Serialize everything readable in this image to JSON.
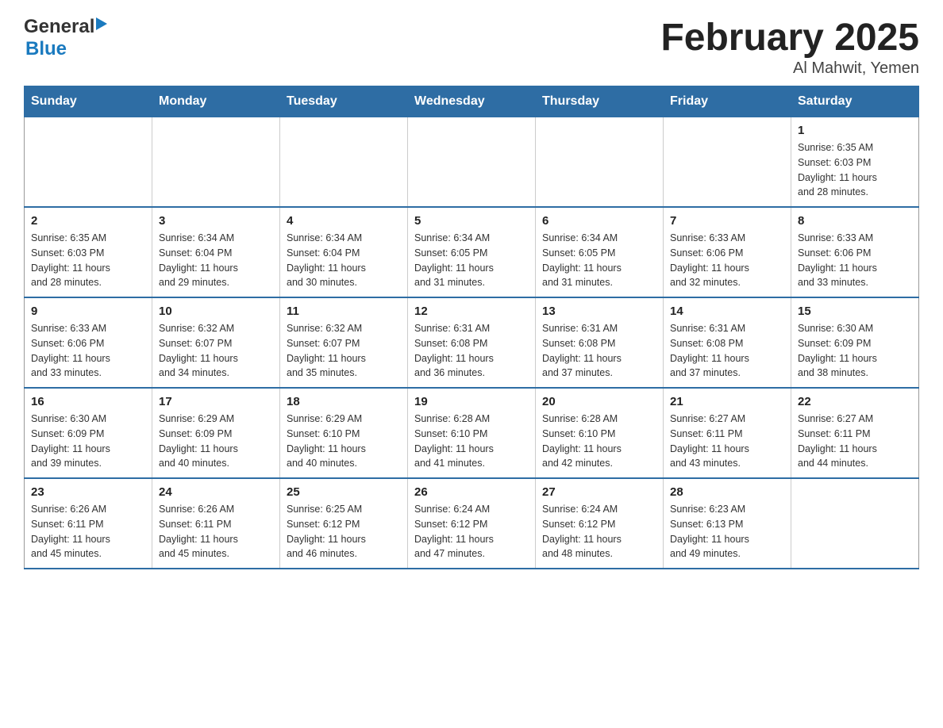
{
  "logo": {
    "general": "General",
    "blue": "Blue"
  },
  "title": "February 2025",
  "subtitle": "Al Mahwit, Yemen",
  "weekdays": [
    "Sunday",
    "Monday",
    "Tuesday",
    "Wednesday",
    "Thursday",
    "Friday",
    "Saturday"
  ],
  "weeks": [
    [
      {
        "day": "",
        "info": ""
      },
      {
        "day": "",
        "info": ""
      },
      {
        "day": "",
        "info": ""
      },
      {
        "day": "",
        "info": ""
      },
      {
        "day": "",
        "info": ""
      },
      {
        "day": "",
        "info": ""
      },
      {
        "day": "1",
        "info": "Sunrise: 6:35 AM\nSunset: 6:03 PM\nDaylight: 11 hours\nand 28 minutes."
      }
    ],
    [
      {
        "day": "2",
        "info": "Sunrise: 6:35 AM\nSunset: 6:03 PM\nDaylight: 11 hours\nand 28 minutes."
      },
      {
        "day": "3",
        "info": "Sunrise: 6:34 AM\nSunset: 6:04 PM\nDaylight: 11 hours\nand 29 minutes."
      },
      {
        "day": "4",
        "info": "Sunrise: 6:34 AM\nSunset: 6:04 PM\nDaylight: 11 hours\nand 30 minutes."
      },
      {
        "day": "5",
        "info": "Sunrise: 6:34 AM\nSunset: 6:05 PM\nDaylight: 11 hours\nand 31 minutes."
      },
      {
        "day": "6",
        "info": "Sunrise: 6:34 AM\nSunset: 6:05 PM\nDaylight: 11 hours\nand 31 minutes."
      },
      {
        "day": "7",
        "info": "Sunrise: 6:33 AM\nSunset: 6:06 PM\nDaylight: 11 hours\nand 32 minutes."
      },
      {
        "day": "8",
        "info": "Sunrise: 6:33 AM\nSunset: 6:06 PM\nDaylight: 11 hours\nand 33 minutes."
      }
    ],
    [
      {
        "day": "9",
        "info": "Sunrise: 6:33 AM\nSunset: 6:06 PM\nDaylight: 11 hours\nand 33 minutes."
      },
      {
        "day": "10",
        "info": "Sunrise: 6:32 AM\nSunset: 6:07 PM\nDaylight: 11 hours\nand 34 minutes."
      },
      {
        "day": "11",
        "info": "Sunrise: 6:32 AM\nSunset: 6:07 PM\nDaylight: 11 hours\nand 35 minutes."
      },
      {
        "day": "12",
        "info": "Sunrise: 6:31 AM\nSunset: 6:08 PM\nDaylight: 11 hours\nand 36 minutes."
      },
      {
        "day": "13",
        "info": "Sunrise: 6:31 AM\nSunset: 6:08 PM\nDaylight: 11 hours\nand 37 minutes."
      },
      {
        "day": "14",
        "info": "Sunrise: 6:31 AM\nSunset: 6:08 PM\nDaylight: 11 hours\nand 37 minutes."
      },
      {
        "day": "15",
        "info": "Sunrise: 6:30 AM\nSunset: 6:09 PM\nDaylight: 11 hours\nand 38 minutes."
      }
    ],
    [
      {
        "day": "16",
        "info": "Sunrise: 6:30 AM\nSunset: 6:09 PM\nDaylight: 11 hours\nand 39 minutes."
      },
      {
        "day": "17",
        "info": "Sunrise: 6:29 AM\nSunset: 6:09 PM\nDaylight: 11 hours\nand 40 minutes."
      },
      {
        "day": "18",
        "info": "Sunrise: 6:29 AM\nSunset: 6:10 PM\nDaylight: 11 hours\nand 40 minutes."
      },
      {
        "day": "19",
        "info": "Sunrise: 6:28 AM\nSunset: 6:10 PM\nDaylight: 11 hours\nand 41 minutes."
      },
      {
        "day": "20",
        "info": "Sunrise: 6:28 AM\nSunset: 6:10 PM\nDaylight: 11 hours\nand 42 minutes."
      },
      {
        "day": "21",
        "info": "Sunrise: 6:27 AM\nSunset: 6:11 PM\nDaylight: 11 hours\nand 43 minutes."
      },
      {
        "day": "22",
        "info": "Sunrise: 6:27 AM\nSunset: 6:11 PM\nDaylight: 11 hours\nand 44 minutes."
      }
    ],
    [
      {
        "day": "23",
        "info": "Sunrise: 6:26 AM\nSunset: 6:11 PM\nDaylight: 11 hours\nand 45 minutes."
      },
      {
        "day": "24",
        "info": "Sunrise: 6:26 AM\nSunset: 6:11 PM\nDaylight: 11 hours\nand 45 minutes."
      },
      {
        "day": "25",
        "info": "Sunrise: 6:25 AM\nSunset: 6:12 PM\nDaylight: 11 hours\nand 46 minutes."
      },
      {
        "day": "26",
        "info": "Sunrise: 6:24 AM\nSunset: 6:12 PM\nDaylight: 11 hours\nand 47 minutes."
      },
      {
        "day": "27",
        "info": "Sunrise: 6:24 AM\nSunset: 6:12 PM\nDaylight: 11 hours\nand 48 minutes."
      },
      {
        "day": "28",
        "info": "Sunrise: 6:23 AM\nSunset: 6:13 PM\nDaylight: 11 hours\nand 49 minutes."
      },
      {
        "day": "",
        "info": ""
      }
    ]
  ]
}
